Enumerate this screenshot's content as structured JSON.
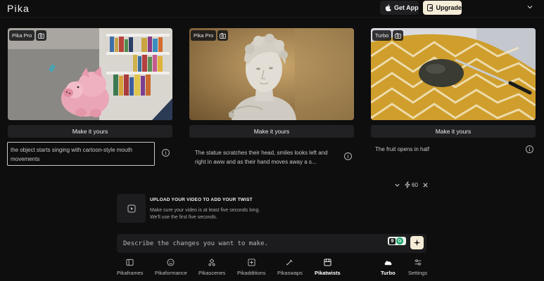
{
  "app": {
    "logo": "Pika",
    "get_app": "Get App",
    "upgrade": "Upgrade"
  },
  "cards": [
    {
      "tag": "Pika Pro",
      "button": "Make it yours",
      "prompt": "the object starts singing with cartoon-style mouth movements"
    },
    {
      "tag": "Pika Pro",
      "button": "Make it yours",
      "prompt": "The statue scratches their head, smiles looks left and right in aww and as their hand moves away a s..."
    },
    {
      "tag": "Turbo",
      "button": "Make it yours",
      "prompt": "The fruit opens in half"
    }
  ],
  "info_glyph": "i",
  "controls": {
    "credits": "60"
  },
  "upload": {
    "title": "UPLOAD YOUR VIDEO TO ADD YOUR TWIST",
    "line1": "Make sure your video is at least five seconds long.",
    "line2": "We'll use the first five seconds."
  },
  "describe": {
    "placeholder": "Describe the changes you want to make."
  },
  "grammarly": {
    "g1": "9",
    "g2": "G"
  },
  "nav": [
    {
      "label": "Pikaframes",
      "icon": "frames-icon"
    },
    {
      "label": "Pikaformance",
      "icon": "performance-icon"
    },
    {
      "label": "Pikascenes",
      "icon": "scenes-icon"
    },
    {
      "label": "Pikadditions",
      "icon": "additions-icon"
    },
    {
      "label": "Pikaswaps",
      "icon": "swaps-icon"
    },
    {
      "label": "Pikatwists",
      "icon": "twists-icon",
      "active": true
    },
    {
      "label": "Turbo",
      "icon": "cloud-icon",
      "active": true
    },
    {
      "label": "Settings",
      "icon": "settings-icon"
    }
  ],
  "colors": {
    "background": "#0e0e0f",
    "accent": "#f5ecd7",
    "card_button": "#212123"
  }
}
